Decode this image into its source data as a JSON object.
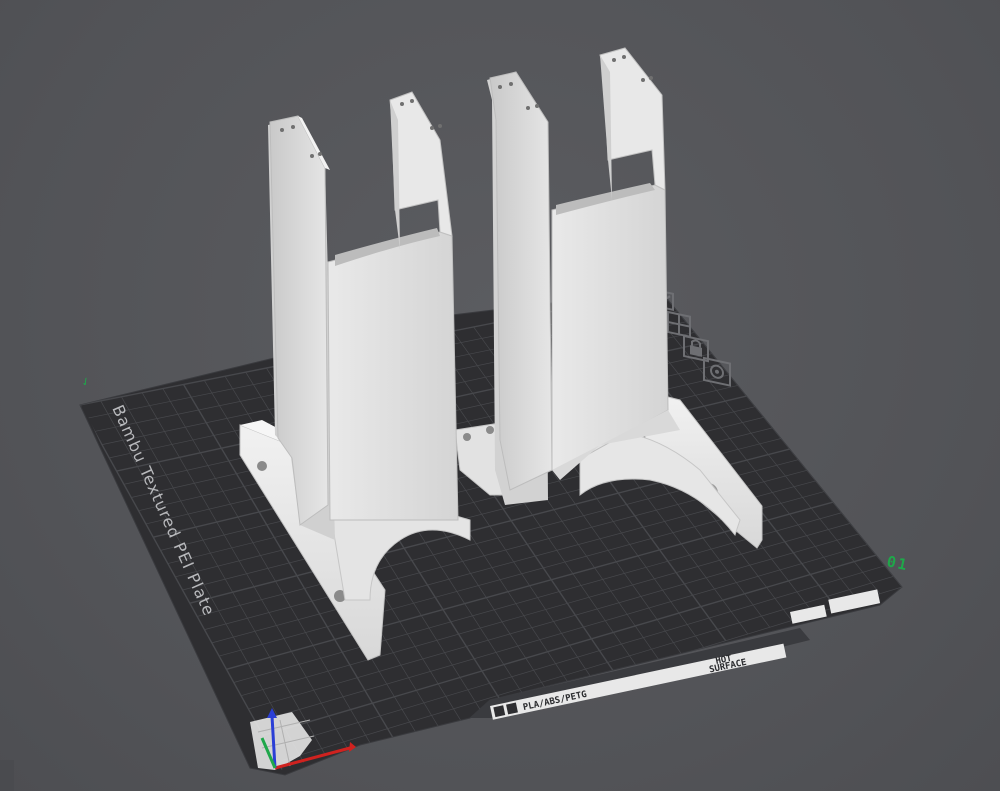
{
  "viewport": {
    "background_color": "#56575b"
  },
  "build_plate": {
    "name": "Bambu Textured PEI Plate",
    "plate_number": "01",
    "surface_color": "#2e2e31",
    "grid_color": "#47484c",
    "material_strip": "PLA/ABS/PETG",
    "hot_surface_label_line1": "HOT",
    "hot_surface_label_line2": "SURFACE"
  },
  "plate_tools": {
    "icons": [
      "arrange-icon",
      "orient-icon",
      "lock-icon",
      "settings-gear-icon"
    ]
  },
  "model": {
    "description": "",
    "color": "#dedede"
  },
  "axes": {
    "x_color": "#d0221f",
    "y_color": "#1fa74a",
    "z_color": "#2b3fd6"
  }
}
